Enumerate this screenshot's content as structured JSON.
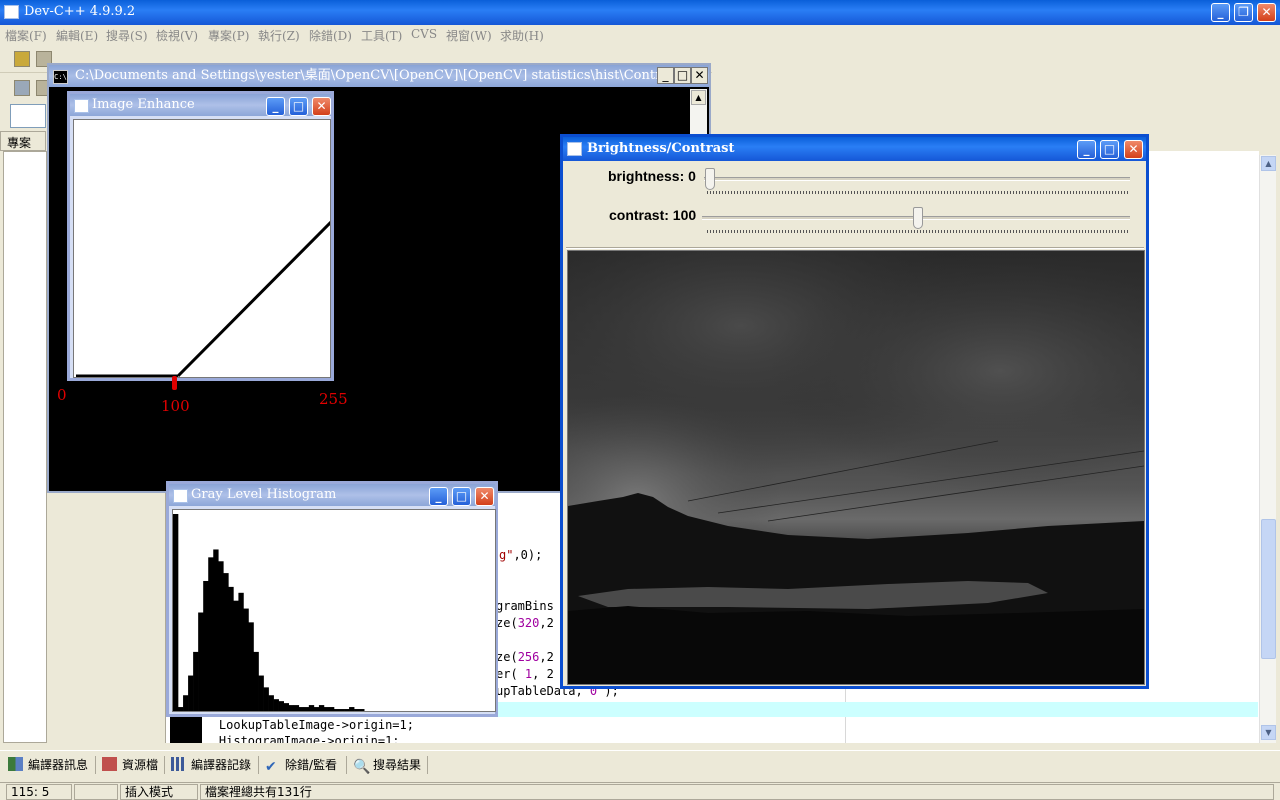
{
  "main": {
    "title": "Dev-C++ 4.9.9.2",
    "menu": [
      "檔案(F)",
      "編輯(E)",
      "搜尋(S)",
      "檢視(V)",
      "專案(P)",
      "執行(Z)",
      "除錯(D)",
      "工具(T)",
      "CVS",
      "視窗(W)",
      "求助(H)"
    ],
    "project_tab": "專案",
    "min_btn": "_",
    "max_btn": "❐",
    "close_btn": "✕"
  },
  "code": {
    "line1_str": "g\"",
    "line1_rest": ",0);",
    "line2": "gramBins",
    "line3a": "ze(",
    "line3b": "320",
    "line3c": ",2",
    "line4a": "ze(",
    "line4b": "256",
    "line4c": ",2",
    "line5a": "er( ",
    "line5b": "1",
    "line5c": ", 2",
    "line6a": "upTableData, ",
    "line6b": "0",
    "line6c": " );",
    "line7": "    LookupTableImage->origin=1;",
    "line8": "    HistogramImage->origin=1;"
  },
  "console": {
    "title": "C:\\Documents and Settings\\yester\\桌面\\OpenCV\\[OpenCV]\\[OpenCV] statistics\\hist\\Contrast.exe",
    "sys_icon": "C:\\"
  },
  "enhance": {
    "title": "Image Enhance",
    "label_0": "0",
    "label_100": "100",
    "label_255": "255"
  },
  "histogram": {
    "title": "Gray Level Histogram",
    "bins": [
      100,
      2,
      8,
      18,
      30,
      50,
      66,
      78,
      82,
      76,
      70,
      63,
      56,
      60,
      52,
      45,
      30,
      18,
      12,
      8,
      6,
      5,
      4,
      3,
      3,
      2,
      2,
      3,
      2,
      3,
      2,
      2,
      1,
      1,
      1,
      2,
      1,
      1,
      0,
      0,
      0,
      0,
      0,
      0,
      0,
      0,
      0,
      0,
      0,
      0,
      0,
      0,
      0,
      0,
      0,
      0,
      0,
      0,
      0,
      0,
      0,
      0,
      0,
      0
    ]
  },
  "bc": {
    "title": "Brightness/Contrast",
    "brightness_label": "brightness: 0",
    "brightness_value": 0,
    "contrast_label": "contrast: 100",
    "contrast_value": 100,
    "slider_max": 200
  },
  "bottom_tabs": [
    "編譯器訊息",
    "資源檔",
    "編譯器記錄",
    "除錯/監看",
    "搜尋結果"
  ],
  "status": {
    "position": "115: 5",
    "mode": "插入模式",
    "lines": "檔案裡總共有131行"
  },
  "colors": {
    "xp_blue": "#0a5fd9",
    "inactive_title": "#8aa4d6",
    "label_red": "#e00000",
    "highlight_row": "#ccffff"
  }
}
